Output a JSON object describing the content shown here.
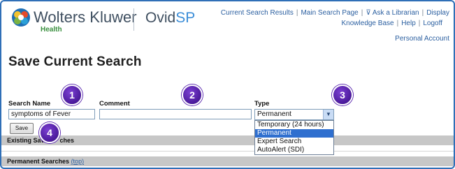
{
  "header": {
    "brand_name": "Wolters Kluwer",
    "brand_sub": "Health",
    "product_ovid": "Ovid",
    "product_sp": "SP",
    "nav_row1": [
      "Current Search Results",
      "Main Search Page",
      "Ask a Librarian",
      "Display"
    ],
    "nav_row2": [
      "Knowledge Base",
      "Help",
      "Logoff"
    ],
    "personal_account": "Personal Account"
  },
  "page": {
    "title": "Save Current Search"
  },
  "form": {
    "search_name_label": "Search Name",
    "search_name_value": "symptoms of Fever",
    "comment_label": "Comment",
    "comment_value": "",
    "type_label": "Type",
    "type_selected": "Permanent",
    "type_options": [
      "Temporary (24 hours)",
      "Permanent",
      "Expert Search",
      "AutoAlert (SDI)"
    ],
    "save_label": "Save"
  },
  "sections": {
    "existing_label_a": "Existing Sav",
    "existing_label_b": "ches",
    "permanent_label": "Permanent Searches",
    "permanent_top_link": "(top)"
  },
  "callouts": [
    "1",
    "2",
    "3",
    "4"
  ],
  "colors": {
    "frame_border": "#2f6fb7",
    "link": "#2b5fa0",
    "callout": "#5a25b0",
    "band": "#c7c7c7",
    "selected": "#2f6fcf"
  }
}
